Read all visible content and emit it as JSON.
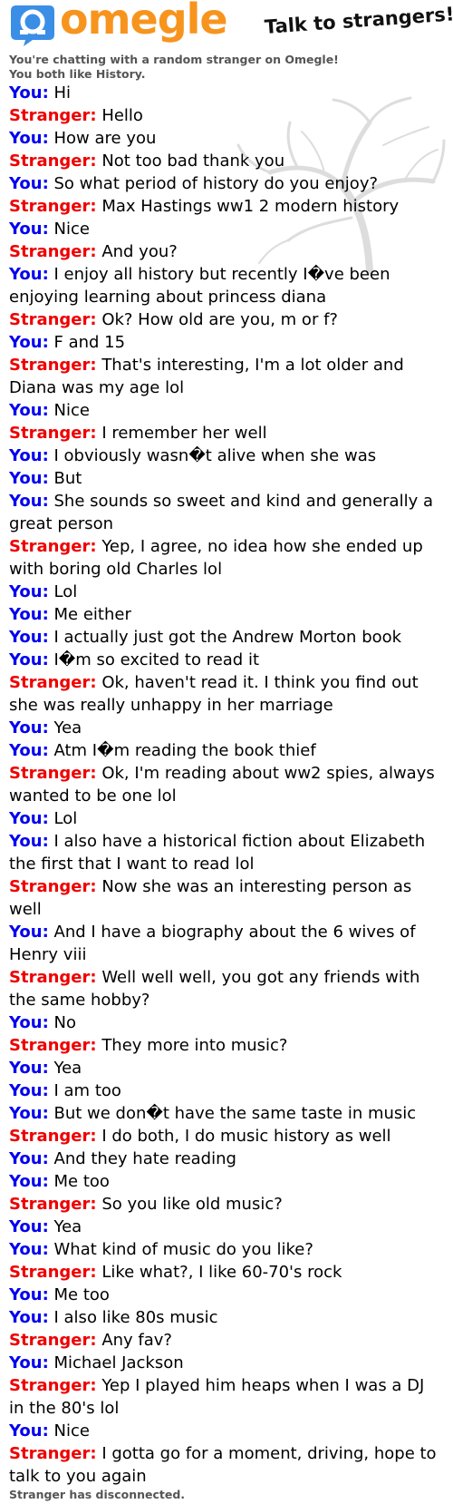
{
  "header": {
    "logo_text": "omegle",
    "tagline": "Talk to strangers!"
  },
  "intro": {
    "line1": "You're chatting with a random stranger on Omegle!",
    "line2": "You both like History."
  },
  "colors": {
    "you": "#0000ee",
    "stranger": "#ee0000",
    "brand": "#f7941e",
    "logo_blue": "#3a8ee6"
  },
  "labels": {
    "you": "You:",
    "stranger": "Stranger:"
  },
  "messages": [
    {
      "from": "you",
      "text": "Hi"
    },
    {
      "from": "stranger",
      "text": "Hello"
    },
    {
      "from": "you",
      "text": "How are you"
    },
    {
      "from": "stranger",
      "text": "Not too bad thank you"
    },
    {
      "from": "you",
      "text": "So what period of history do you enjoy?"
    },
    {
      "from": "stranger",
      "text": "Max Hastings ww1 2 modern history"
    },
    {
      "from": "you",
      "text": "Nice"
    },
    {
      "from": "stranger",
      "text": "And you?"
    },
    {
      "from": "you",
      "text": "I enjoy all history but recently I�ve been enjoying learning about princess diana"
    },
    {
      "from": "stranger",
      "text": "Ok? How old are you, m or f?"
    },
    {
      "from": "you",
      "text": "F and 15"
    },
    {
      "from": "stranger",
      "text": "That's interesting, I'm a lot older and Diana was my age lol"
    },
    {
      "from": "you",
      "text": "Nice"
    },
    {
      "from": "stranger",
      "text": "I remember her well"
    },
    {
      "from": "you",
      "text": "I obviously wasn�t alive when she was"
    },
    {
      "from": "you",
      "text": "But"
    },
    {
      "from": "you",
      "text": "She sounds so sweet and kind and generally a great person"
    },
    {
      "from": "stranger",
      "text": "Yep, I agree, no idea how she ended up with boring old Charles lol"
    },
    {
      "from": "you",
      "text": "Lol"
    },
    {
      "from": "you",
      "text": "Me either"
    },
    {
      "from": "you",
      "text": "I actually just got the Andrew Morton book"
    },
    {
      "from": "you",
      "text": "I�m so excited to read it"
    },
    {
      "from": "stranger",
      "text": "Ok, haven't read it. I think you find out she was really unhappy in her marriage"
    },
    {
      "from": "you",
      "text": "Yea"
    },
    {
      "from": "you",
      "text": "Atm I�m reading the book thief"
    },
    {
      "from": "stranger",
      "text": "Ok, I'm reading about ww2 spies, always wanted to be one lol"
    },
    {
      "from": "you",
      "text": "Lol"
    },
    {
      "from": "you",
      "text": "I also have a historical fiction about Elizabeth the first that I want to read lol"
    },
    {
      "from": "stranger",
      "text": "Now she was an interesting person as well"
    },
    {
      "from": "you",
      "text": "And I have a biography about the 6 wives of Henry viii"
    },
    {
      "from": "stranger",
      "text": "Well well well, you got any friends with the same hobby?"
    },
    {
      "from": "you",
      "text": "No"
    },
    {
      "from": "stranger",
      "text": "They more into music?"
    },
    {
      "from": "you",
      "text": "Yea"
    },
    {
      "from": "you",
      "text": "I am too"
    },
    {
      "from": "you",
      "text": "But we don�t have the same taste in music"
    },
    {
      "from": "stranger",
      "text": "I do both, I do music history as well"
    },
    {
      "from": "you",
      "text": "And they hate reading"
    },
    {
      "from": "you",
      "text": "Me too"
    },
    {
      "from": "stranger",
      "text": "So you like old music?"
    },
    {
      "from": "you",
      "text": "Yea"
    },
    {
      "from": "you",
      "text": "What kind of music do you like?"
    },
    {
      "from": "stranger",
      "text": "Like what?, I like 60-70's rock"
    },
    {
      "from": "you",
      "text": "Me too"
    },
    {
      "from": "you",
      "text": "I also like 80s music"
    },
    {
      "from": "stranger",
      "text": "Any fav?"
    },
    {
      "from": "you",
      "text": "Michael Jackson"
    },
    {
      "from": "stranger",
      "text": "Yep I played him heaps when I was a DJ in the 80's lol"
    },
    {
      "from": "you",
      "text": "Nice"
    },
    {
      "from": "stranger",
      "text": "I gotta go for a moment, driving, hope to talk to you again"
    }
  ],
  "status": "Stranger has disconnected."
}
